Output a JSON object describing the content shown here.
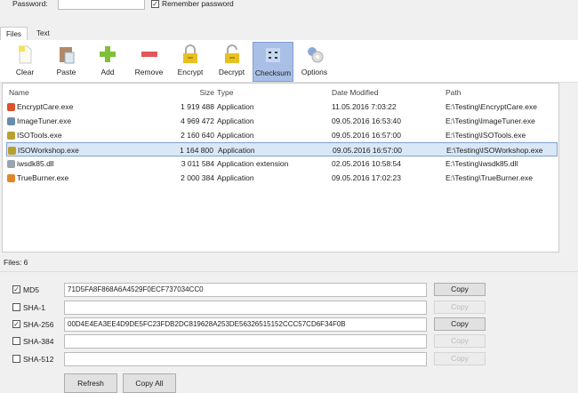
{
  "top": {
    "password_label": "Password:",
    "password_value": "",
    "remember_label": "Remember password",
    "remember_checked": true
  },
  "tabs": [
    {
      "label": "Files",
      "active": true
    },
    {
      "label": "Text",
      "active": false
    }
  ],
  "toolbar": [
    {
      "label": "Clear",
      "icon": "file-icon"
    },
    {
      "label": "Paste",
      "icon": "clipboard-icon"
    },
    {
      "label": "Add",
      "icon": "plus-icon"
    },
    {
      "label": "Remove",
      "icon": "minus-icon"
    },
    {
      "label": "Encrypt",
      "icon": "lock-icon"
    },
    {
      "label": "Decrypt",
      "icon": "unlock-icon"
    },
    {
      "label": "Checksum",
      "icon": "checksum-icon",
      "active": true
    },
    {
      "label": "Options",
      "icon": "gear-icon"
    }
  ],
  "columns": {
    "name": "Name",
    "size": "Size",
    "type": "Type",
    "date": "Date Modified",
    "path": "Path"
  },
  "files": [
    {
      "name": "EncryptCare.exe",
      "size": "1 919 488",
      "type": "Application",
      "date": "11.05.2016 7:03:22",
      "path": "E:\\Testing\\EncryptCare.exe",
      "color": "#d9532c"
    },
    {
      "name": "ImageTuner.exe",
      "size": "4 969 472",
      "type": "Application",
      "date": "09.05.2016 16:53:40",
      "path": "E:\\Testing\\ImageTuner.exe",
      "color": "#6a8caf"
    },
    {
      "name": "ISOTools.exe",
      "size": "2 160 640",
      "type": "Application",
      "date": "09.05.2016 16:57:00",
      "path": "E:\\Testing\\ISOTools.exe",
      "color": "#b8a030"
    },
    {
      "name": "ISOWorkshop.exe",
      "size": "1 164 800",
      "type": "Application",
      "date": "09.05.2016 16:57:00",
      "path": "E:\\Testing\\ISOWorkshop.exe",
      "color": "#b8a030",
      "selected": true
    },
    {
      "name": "iwsdk85.dll",
      "size": "3 011 584",
      "type": "Application extension",
      "date": "02.05.2016 10:58:54",
      "path": "E:\\Testing\\iwsdk85.dll",
      "color": "#9aa4b0"
    },
    {
      "name": "TrueBurner.exe",
      "size": "2 000 384",
      "type": "Application",
      "date": "09.05.2016 17:02:23",
      "path": "E:\\Testing\\TrueBurner.exe",
      "color": "#e0862a"
    }
  ],
  "status": "Files: 6",
  "hashes": [
    {
      "label": "MD5",
      "checked": true,
      "value": "71D5FA8F868A6A4529F0ECF737034CC0",
      "copy": "Copy"
    },
    {
      "label": "SHA-1",
      "checked": false,
      "value": "",
      "copy": "Copy"
    },
    {
      "label": "SHA-256",
      "checked": true,
      "value": "00D4E4EA3EE4D9DE5FC23FDB2DC819628A253DE56326515152CCC57CD6F34F0B",
      "copy": "Copy"
    },
    {
      "label": "SHA-384",
      "checked": false,
      "value": "",
      "copy": "Copy"
    },
    {
      "label": "SHA-512",
      "checked": false,
      "value": "",
      "copy": "Copy"
    }
  ],
  "buttons": {
    "refresh": "Refresh",
    "copy_all": "Copy All"
  }
}
